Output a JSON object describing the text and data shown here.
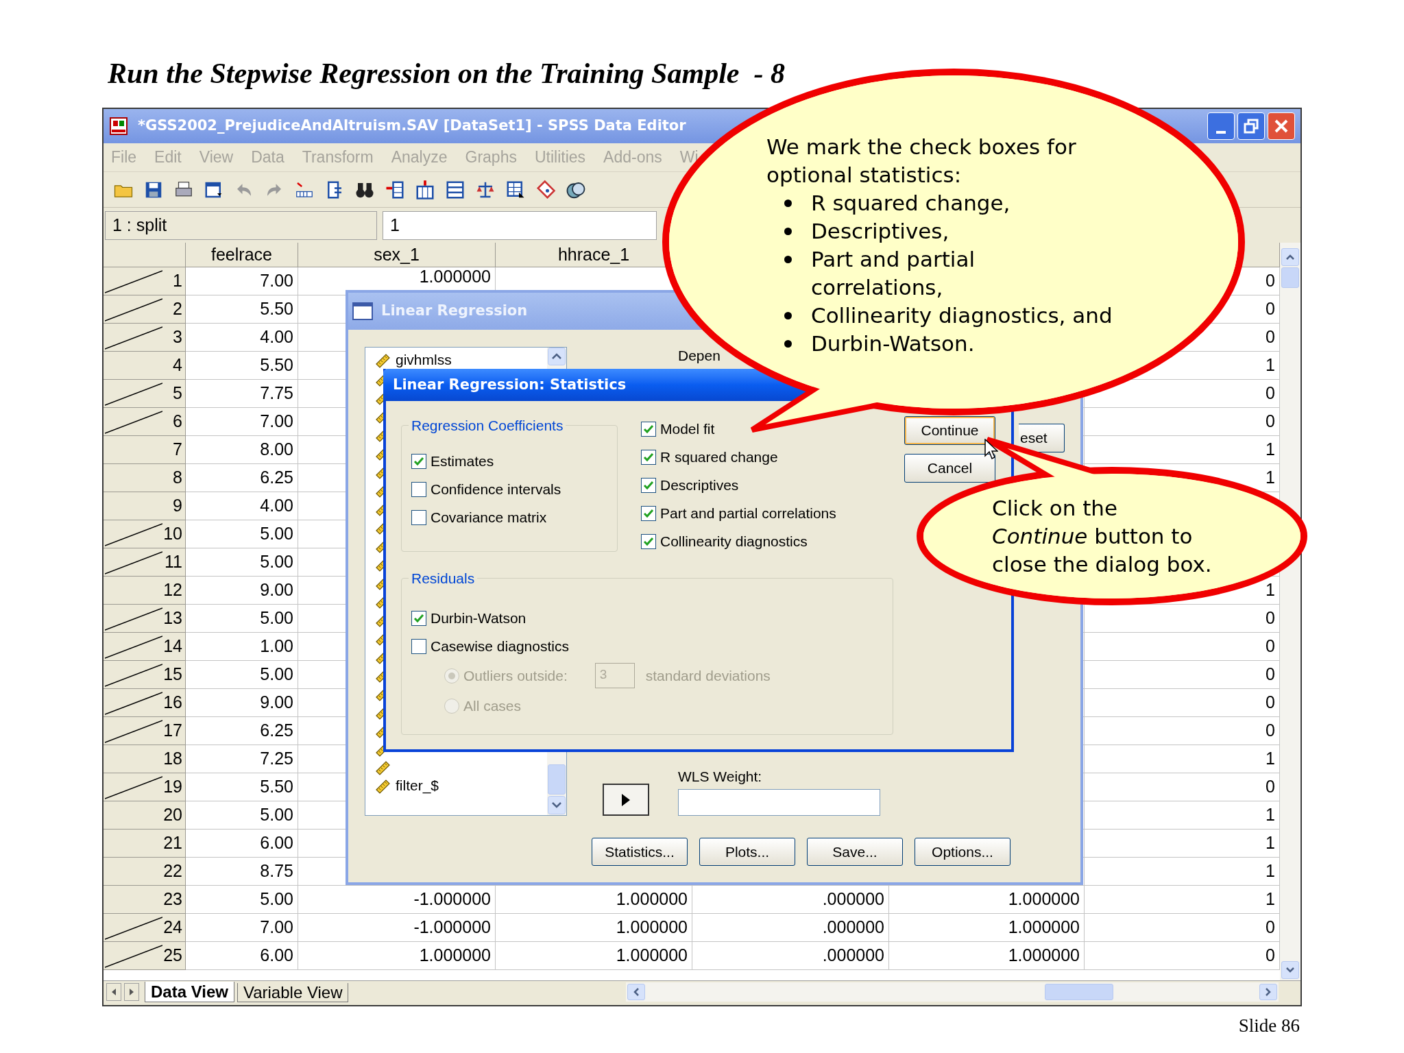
{
  "slide": {
    "title": "Run the Stepwise Regression on the Training Sample  - 8",
    "footer": "Slide 86"
  },
  "window": {
    "title": "*GSS2002_PrejudiceAndAltruism.SAV [DataSet1] - SPSS Data Editor"
  },
  "menu": [
    "File",
    "Edit",
    "View",
    "Data",
    "Transform",
    "Analyze",
    "Graphs",
    "Utilities",
    "Add-ons",
    "Wi"
  ],
  "cell_editor": {
    "cell": "1 : split",
    "value": "1"
  },
  "grid": {
    "columns": [
      "feelrace",
      "sex_1",
      "hhrace_1"
    ],
    "rows": [
      {
        "case": "1",
        "filtered": true,
        "feelrace": "7.00",
        "sex_1": "1.000000",
        "column_6": "0"
      },
      {
        "case": "2",
        "filtered": true,
        "feelrace": "5.50",
        "column_6": "0"
      },
      {
        "case": "3",
        "filtered": true,
        "feelrace": "4.00",
        "column_6": "0"
      },
      {
        "case": "4",
        "filtered": false,
        "feelrace": "5.50",
        "column_6": "1"
      },
      {
        "case": "5",
        "filtered": true,
        "feelrace": "7.75",
        "column_6": "0"
      },
      {
        "case": "6",
        "filtered": true,
        "feelrace": "7.00",
        "column_6": "0"
      },
      {
        "case": "7",
        "filtered": false,
        "feelrace": "8.00",
        "column_6": "1"
      },
      {
        "case": "8",
        "filtered": false,
        "feelrace": "6.25",
        "column_6": "1"
      },
      {
        "case": "9",
        "filtered": false,
        "feelrace": "4.00"
      },
      {
        "case": "10",
        "filtered": true,
        "feelrace": "5.00"
      },
      {
        "case": "11",
        "filtered": true,
        "feelrace": "5.00"
      },
      {
        "case": "12",
        "filtered": false,
        "feelrace": "9.00",
        "column_6": "1"
      },
      {
        "case": "13",
        "filtered": true,
        "feelrace": "5.00",
        "column_6": "0"
      },
      {
        "case": "14",
        "filtered": true,
        "feelrace": "1.00",
        "column_6": "0"
      },
      {
        "case": "15",
        "filtered": true,
        "feelrace": "5.00",
        "column_6": "0"
      },
      {
        "case": "16",
        "filtered": true,
        "feelrace": "9.00",
        "column_6": "0"
      },
      {
        "case": "17",
        "filtered": true,
        "feelrace": "6.25",
        "column_6": "0"
      },
      {
        "case": "18",
        "filtered": false,
        "feelrace": "7.25",
        "column_6": "1"
      },
      {
        "case": "19",
        "filtered": true,
        "feelrace": "5.50",
        "column_6": "0"
      },
      {
        "case": "20",
        "filtered": false,
        "feelrace": "5.00",
        "column_6": "1"
      },
      {
        "case": "21",
        "filtered": false,
        "feelrace": "6.00",
        "column_6": "1"
      },
      {
        "case": "22",
        "filtered": false,
        "feelrace": "8.75",
        "column_6": "1"
      },
      {
        "case": "23",
        "filtered": false,
        "feelrace": "5.00",
        "sex_1": "-1.000000",
        "hhrace_1": "1.000000",
        "column_4": ".000000",
        "column_5": "1.000000",
        "column_6": "1"
      },
      {
        "case": "24",
        "filtered": true,
        "feelrace": "7.00",
        "sex_1": "-1.000000",
        "hhrace_1": "1.000000",
        "column_4": ".000000",
        "column_5": "1.000000",
        "column_6": "0"
      },
      {
        "case": "25",
        "filtered": true,
        "feelrace": "6.00",
        "sex_1": "1.000000",
        "hhrace_1": "1.000000",
        "column_4": ".000000",
        "column_5": "1.000000",
        "column_6": "0"
      }
    ]
  },
  "sheet_tabs": [
    {
      "label": "Data View",
      "selected": true
    },
    {
      "label": "Variable View",
      "selected": false
    }
  ],
  "regression_dialog": {
    "title": "Linear Regression",
    "variables": [
      {
        "name": "givhmlss"
      },
      {
        "name": "filter_$"
      }
    ],
    "dependent_label": "Depen",
    "wls_label": "WLS Weight:",
    "buttons": [
      "Statistics...",
      "Plots...",
      "Save...",
      "Options..."
    ],
    "side_buttons": [
      "eset"
    ]
  },
  "statistics_dialog": {
    "title": "Linear Regression: Statistics",
    "coefficients": {
      "legend": "Regression Coefficients",
      "options": [
        {
          "label": "Estimates",
          "checked": true
        },
        {
          "label": "Confidence intervals",
          "checked": false
        },
        {
          "label": "Covariance matrix",
          "checked": false
        }
      ]
    },
    "model_options": [
      {
        "label": "Model fit",
        "checked": true
      },
      {
        "label": "R squared change",
        "checked": true
      },
      {
        "label": "Descriptives",
        "checked": true
      },
      {
        "label": "Part and partial correlations",
        "checked": true
      },
      {
        "label": "Collinearity diagnostics",
        "checked": true
      }
    ],
    "residuals": {
      "legend": "Residuals",
      "options": [
        {
          "label": "Durbin-Watson",
          "checked": true
        },
        {
          "label": "Casewise diagnostics",
          "checked": false
        }
      ],
      "outliers": {
        "disabled": true,
        "choices": [
          {
            "label": "Outliers outside:",
            "selected": true
          },
          {
            "label": "All cases",
            "selected": false
          }
        ],
        "value": "3",
        "unit": "standard deviations"
      }
    },
    "buttons": [
      {
        "label": "Continue",
        "focused": true
      },
      {
        "label": "Cancel",
        "focused": false
      }
    ]
  },
  "callouts": [
    {
      "kind": "bullets",
      "intro": [
        "We mark the check boxes for",
        "optional statistics:"
      ],
      "bullets": [
        {
          "lines": [
            "R squared change,"
          ]
        },
        {
          "lines": [
            "Descriptives,"
          ]
        },
        {
          "lines": [
            "Part and partial",
            "correlations,"
          ]
        },
        {
          "lines": [
            "Collinearity diagnostics, and"
          ]
        },
        {
          "lines": [
            "Durbin-Watson."
          ]
        }
      ]
    },
    {
      "kind": "text",
      "lines": [
        "Click on the",
        "*Continue* button to",
        "close the dialog box."
      ]
    }
  ]
}
